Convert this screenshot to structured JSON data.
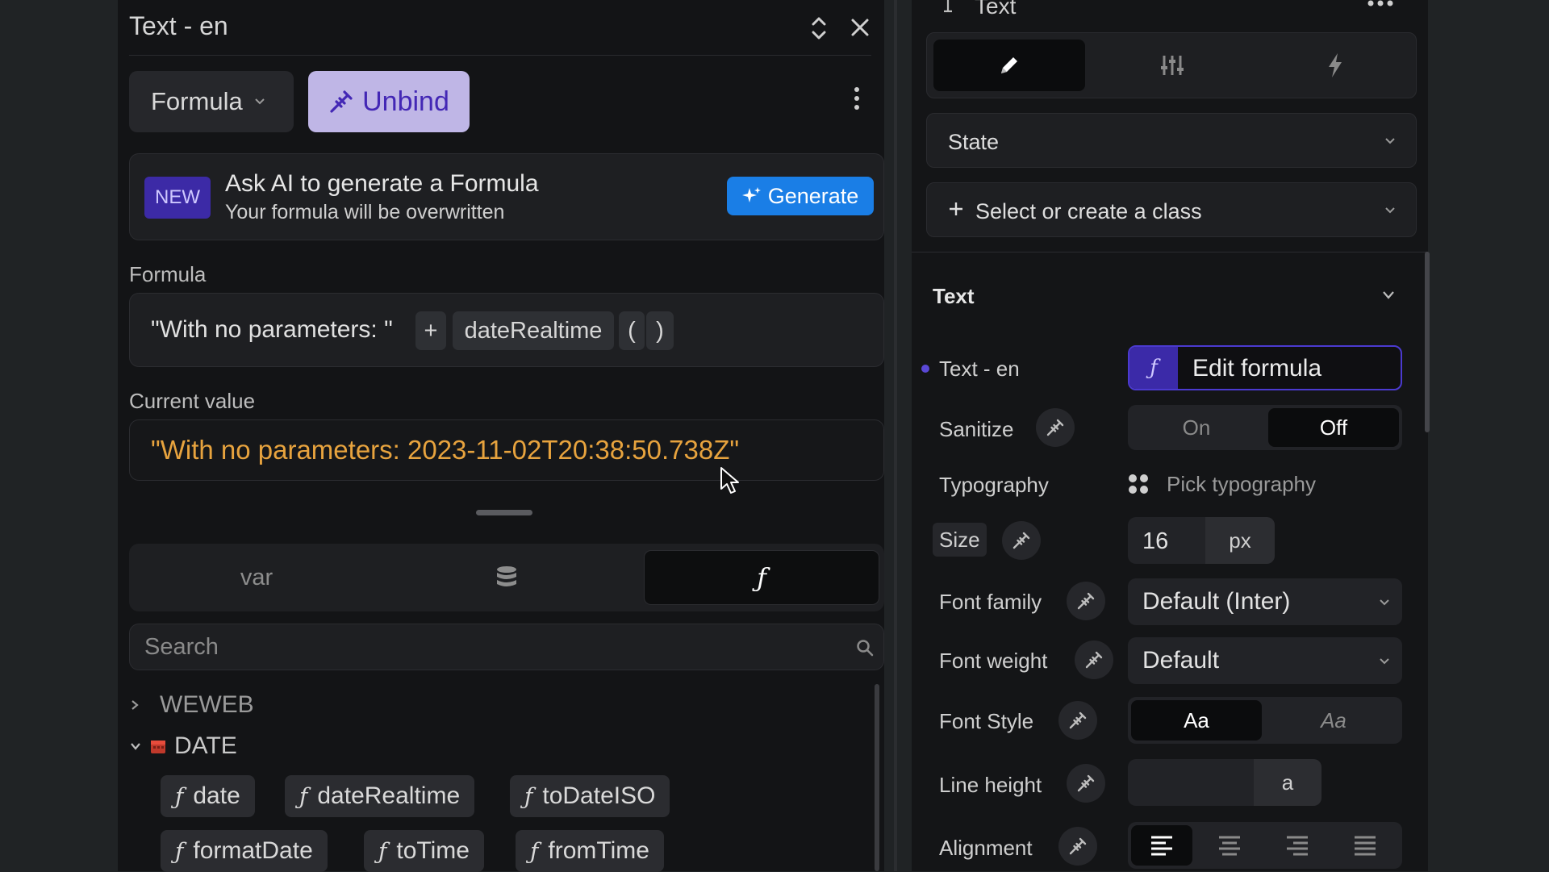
{
  "formula_panel": {
    "title": "Text - en",
    "mode_dropdown": "Formula",
    "unbind_label": "Unbind",
    "ai_banner": {
      "badge": "NEW",
      "title": "Ask AI to generate a Formula",
      "subtitle": "Your formula will be overwritten",
      "generate_label": "Generate"
    },
    "formula_label": "Formula",
    "formula_tokens": {
      "string": "\"With no parameters: \"",
      "operator": "+",
      "function": "dateRealtime",
      "open_paren": "(",
      "close_paren": ")"
    },
    "current_value_label": "Current value",
    "current_value": "\"With no parameters: 2023-11-02T20:38:50.738Z\"",
    "tabs": [
      {
        "label": "var"
      },
      {
        "icon": "database-icon"
      },
      {
        "label": "ƒ"
      }
    ],
    "search_placeholder": "Search",
    "categories": [
      {
        "name": "WEWEB",
        "expanded": false
      },
      {
        "name": "DATE",
        "expanded": true,
        "icon": "calendar-icon"
      }
    ],
    "date_functions": [
      "date",
      "dateRealtime",
      "toDateISO",
      "formatDate",
      "toTime",
      "fromTime"
    ],
    "function_glyph": "ƒ"
  },
  "properties_panel": {
    "element_label": "Text",
    "state_label": "State",
    "class_placeholder": "Select or create a class",
    "section_title": "Text",
    "text_en_label": "Text - en",
    "edit_formula_label": "Edit formula",
    "sanitize": {
      "label": "Sanitize",
      "on": "On",
      "off": "Off",
      "selected": "Off"
    },
    "typography": {
      "label": "Typography",
      "value": "Pick typography"
    },
    "size": {
      "label": "Size",
      "value": "16",
      "unit": "px"
    },
    "font_family": {
      "label": "Font family",
      "value": "Default (Inter)"
    },
    "font_weight": {
      "label": "Font weight",
      "value": "Default"
    },
    "font_style": {
      "label": "Font Style",
      "normal": "Aa",
      "italic": "Aa",
      "selected": "normal"
    },
    "line_height": {
      "label": "Line height",
      "unit": "a"
    },
    "alignment": {
      "label": "Alignment",
      "options": [
        "align-left-icon",
        "align-center-icon",
        "align-right-icon",
        "align-justify-icon"
      ],
      "selected": "align-left-icon"
    }
  },
  "colors": {
    "accent_purple": "#3b2aa8",
    "current_value_orange": "#e7a33e",
    "generate_blue": "#1a7ee6",
    "unbind_bg": "#bfb6e6"
  }
}
